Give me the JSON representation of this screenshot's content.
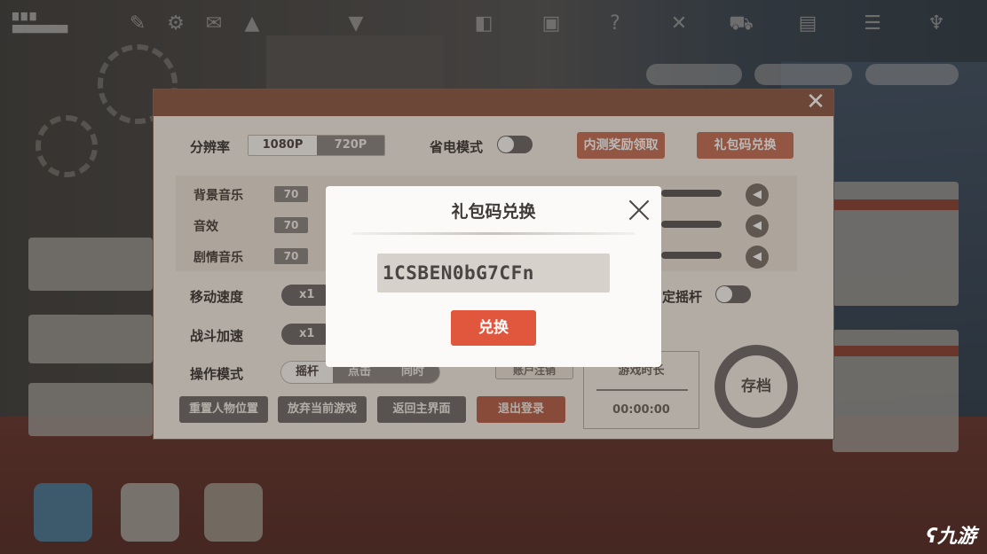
{
  "settings": {
    "resolution_label": "分辨率",
    "resolution_options": [
      "1080P",
      "720P"
    ],
    "power_saving_label": "省电模式",
    "beta_reward_button": "内测奖励领取",
    "gift_code_button": "礼包码兑换",
    "audio": [
      {
        "label": "背景音乐",
        "value": "70"
      },
      {
        "label": "音效",
        "value": "70"
      },
      {
        "label": "剧情音乐",
        "value": "70"
      }
    ],
    "move_speed_label": "移动速度",
    "move_speed_value": "x1",
    "battle_speed_label": "战斗加速",
    "battle_speed_value": "x1",
    "control_mode_label": "操作模式",
    "control_modes": [
      "摇杆",
      "点击",
      "同时"
    ],
    "fixed_joystick_label": "定摇杆",
    "account_button": "账户注销",
    "playtime_label": "游戏时长",
    "playtime_value": "00:00:00",
    "save_button": "存档",
    "bottom_buttons": [
      "重置人物位置",
      "放弃当前游戏",
      "返回主界面",
      "退出登录"
    ],
    "close_glyph": "✕"
  },
  "modal": {
    "title": "礼包码兑换",
    "code_value": "1CSBEN0bG7CFn",
    "redeem_button": "兑换"
  },
  "watermark": "九游",
  "colors": {
    "accent_red": "#e1573d",
    "panel_header": "#8c5640",
    "panel_bg": "#f4ece3",
    "button_brown": "#c56e52"
  }
}
